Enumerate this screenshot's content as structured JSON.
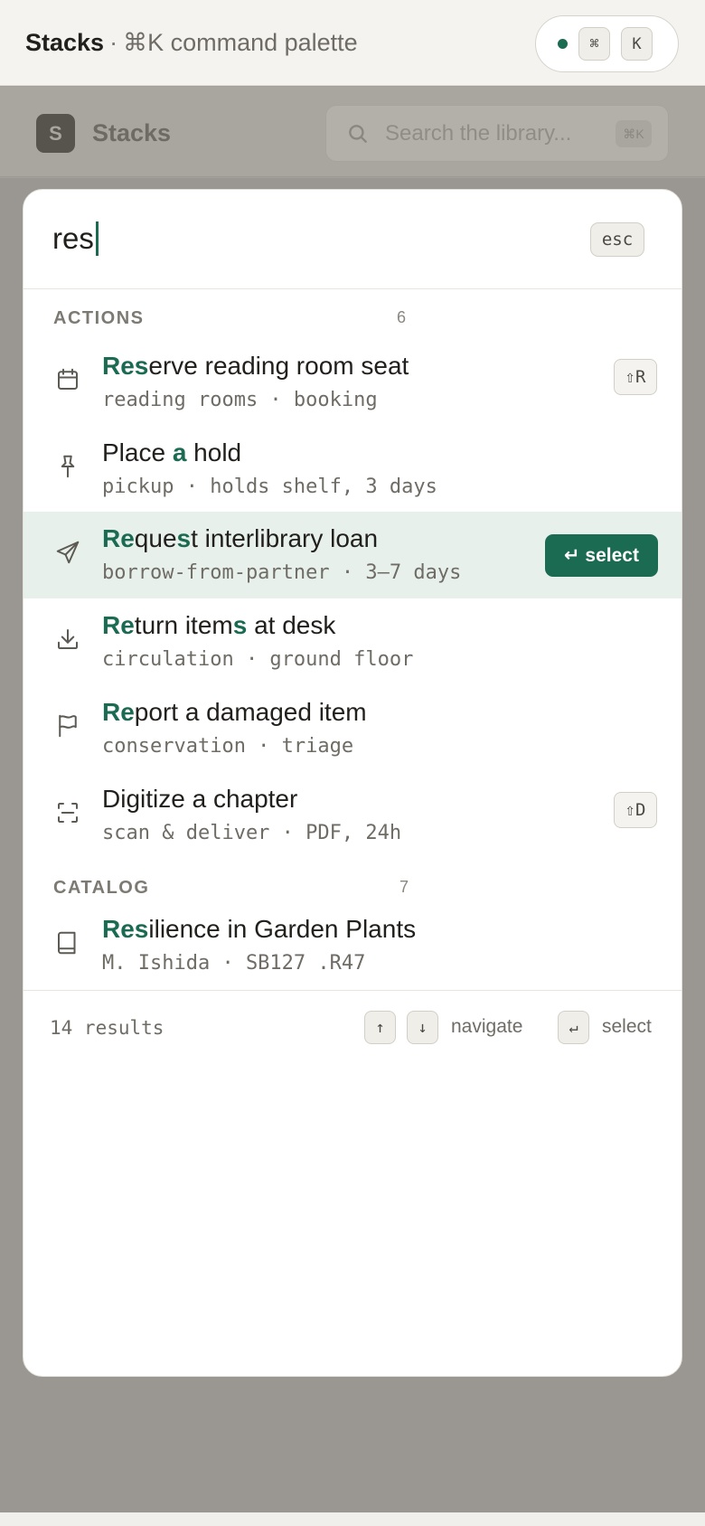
{
  "topbar": {
    "brand": "Stacks",
    "separator": "·",
    "subtitle": "⌘K command palette",
    "status_color": "#1a6b51",
    "keys": [
      "⌘",
      "K"
    ]
  },
  "background_app": {
    "logo_letter": "S",
    "title": "Stacks",
    "search_placeholder": "Search the library...",
    "search_shortcut": "⌘K"
  },
  "palette": {
    "query": "res",
    "esc_label": "esc",
    "accent_color": "#1a6b51",
    "sections": [
      {
        "title": "ACTIONS",
        "count": "6",
        "items": [
          {
            "icon": "calendar-icon",
            "title_parts": [
              "Res",
              "erve reading room seat"
            ],
            "subtitle": "reading rooms · booking",
            "shortcut": "⇧R"
          },
          {
            "icon": "pin-icon",
            "title_parts": [
              "Place ",
              "a",
              " hold"
            ],
            "subtitle": "pickup · holds shelf, 3 days"
          },
          {
            "icon": "send-icon",
            "title_parts": [
              "Re",
              "que",
              "s",
              "t interlibrary loan"
            ],
            "subtitle": "borrow-from-partner · 3–7 days",
            "active": true,
            "select_label": "↵ select"
          },
          {
            "icon": "download-icon",
            "title_parts": [
              "Re",
              "turn item",
              "s",
              " at desk"
            ],
            "subtitle": "circulation · ground floor"
          },
          {
            "icon": "flag-icon",
            "title_parts": [
              "Re",
              "port a damaged item"
            ],
            "subtitle": "conservation · triage"
          },
          {
            "icon": "scan-icon",
            "title_parts": [
              "Digitize a chapter"
            ],
            "subtitle": "scan & deliver · PDF, 24h",
            "shortcut": "⇧D"
          }
        ]
      },
      {
        "title": "CATALOG",
        "count": "7",
        "items": [
          {
            "icon": "book-icon",
            "title_parts": [
              "Res",
              "ilience in Garden Plants"
            ],
            "subtitle": "M. Ishida · SB127 .R47"
          }
        ]
      }
    ],
    "footer": {
      "result_count": "14 results",
      "up_key": "↑",
      "down_key": "↓",
      "navigate_label": "navigate",
      "enter_key": "↵",
      "select_label": "select"
    }
  }
}
